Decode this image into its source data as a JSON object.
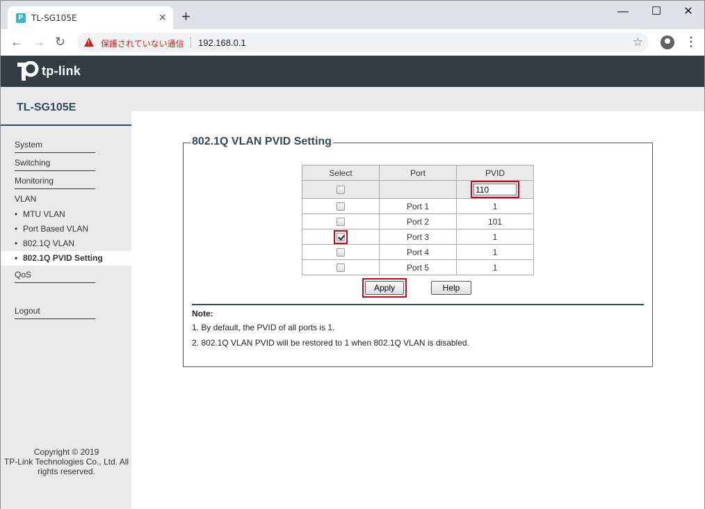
{
  "browser": {
    "tab_title": "TL-SG105E",
    "favicon": "P",
    "tab_close": "×",
    "new_tab": "+",
    "minimize": "—",
    "maximize": "☐",
    "close": "✕",
    "back": "←",
    "forward": "→",
    "reload": "↻",
    "security_warning": "保護されていない通信",
    "url": "192.168.0.1",
    "star": "☆",
    "menu": "⋮"
  },
  "header": {
    "logo_text": "tp-link",
    "model": "TL-SG105E"
  },
  "sidebar": {
    "items": [
      {
        "label": "System"
      },
      {
        "label": "Switching"
      },
      {
        "label": "Monitoring"
      },
      {
        "label": "VLAN"
      }
    ],
    "sub_items": [
      {
        "label": "MTU VLAN"
      },
      {
        "label": "Port Based VLAN"
      },
      {
        "label": "802.1Q VLAN"
      },
      {
        "label": "802.1Q PVID Setting"
      }
    ],
    "qos": "QoS",
    "logout": "Logout",
    "bullet": "•",
    "copyright": [
      "Copyright © 2019",
      "TP-Link Technologies Co., Ltd. All",
      "rights reserved."
    ]
  },
  "panel": {
    "title": "802.1Q VLAN PVID Setting",
    "columns": [
      "Select",
      "Port",
      "PVID"
    ],
    "input_value": "110",
    "rows": [
      {
        "port": "Port 1",
        "pvid": "1",
        "checked": false
      },
      {
        "port": "Port 2",
        "pvid": "101",
        "checked": false
      },
      {
        "port": "Port 3",
        "pvid": "1",
        "checked": true
      },
      {
        "port": "Port 4",
        "pvid": "1",
        "checked": false
      },
      {
        "port": "Port 5",
        "pvid": "1",
        "checked": false
      }
    ],
    "apply_label": "Apply",
    "help_label": "Help",
    "note_title": "Note:",
    "notes": [
      "1. By default, the PVID of all ports is 1.",
      "2. 802.1Q VLAN PVID will be restored to 1 when 802.1Q VLAN is disabled."
    ]
  }
}
